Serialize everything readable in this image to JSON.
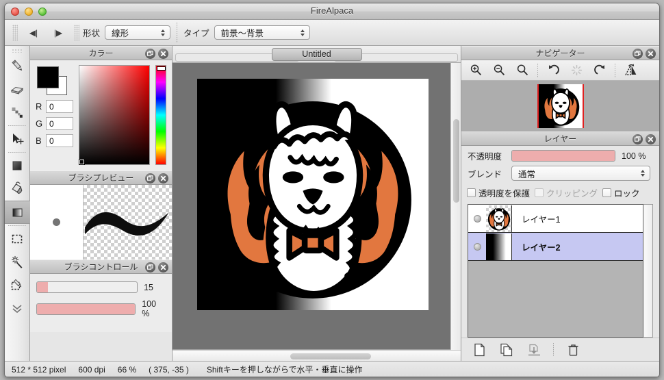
{
  "window": {
    "title": "FireAlpaca",
    "traffic_lights": [
      "close",
      "minimize",
      "zoom"
    ]
  },
  "option_bar": {
    "prev_label": "◀|",
    "next_label": "|▶",
    "shape": {
      "label": "形状",
      "value": "線形"
    },
    "type": {
      "label": "タイプ",
      "value": "前景～背景"
    }
  },
  "tools": [
    {
      "name": "pencil-tool",
      "label": "鉛筆",
      "active": false
    },
    {
      "name": "eraser-tool",
      "label": "消しゴム",
      "active": false
    },
    {
      "name": "blur-tool",
      "label": "ぼかし",
      "active": false
    },
    {
      "name": "move-tool",
      "label": "移動",
      "active": false
    },
    {
      "name": "fill-tool",
      "label": "塗りつぶし",
      "active": false
    },
    {
      "name": "bucket-tool",
      "label": "バケツ",
      "active": false
    },
    {
      "name": "gradient-tool",
      "label": "グラデーション",
      "active": true
    },
    {
      "name": "rect-select-tool",
      "label": "選択範囲",
      "active": false
    },
    {
      "name": "magic-wand-tool",
      "label": "自動選択",
      "active": false
    },
    {
      "name": "select-pen-tool",
      "label": "選択ペン",
      "active": false
    },
    {
      "name": "more-tools",
      "label": "その他",
      "active": false
    }
  ],
  "color_panel": {
    "title": "カラー",
    "foreground": "#000000",
    "background": "#ffffff",
    "channels": [
      {
        "label": "R",
        "value": "0"
      },
      {
        "label": "G",
        "value": "0"
      },
      {
        "label": "B",
        "value": "0"
      }
    ]
  },
  "brush_preview": {
    "title": "ブラシプレビュー"
  },
  "brush_control": {
    "title": "ブラシコントロール",
    "size": {
      "value": "15",
      "percent": 11
    },
    "opacity": {
      "value": "100 %",
      "percent": 100
    }
  },
  "canvas": {
    "tab_title": "Untitled",
    "zoom_percent": "66 %"
  },
  "navigator": {
    "title": "ナビゲーター",
    "tools": [
      {
        "name": "zoom-in-icon",
        "label": "拡大"
      },
      {
        "name": "zoom-out-icon",
        "label": "縮小"
      },
      {
        "name": "zoom-reset-icon",
        "label": "等倍"
      },
      {
        "name": "rotate-left-icon",
        "label": "左回転"
      },
      {
        "name": "rotate-reset-icon",
        "label": "回転リセット"
      },
      {
        "name": "rotate-right-icon",
        "label": "右回転"
      },
      {
        "name": "flip-horizontal-icon",
        "label": "左右反転"
      }
    ]
  },
  "layers_panel": {
    "title": "レイヤー",
    "opacity": {
      "label": "不透明度",
      "value": "100 %",
      "percent": 100
    },
    "blend": {
      "label": "ブレンド",
      "value": "通常"
    },
    "checkboxes": [
      {
        "label": "透明度を保護",
        "checked": false,
        "disabled": false
      },
      {
        "label": "クリッピング",
        "checked": false,
        "disabled": true
      },
      {
        "label": "ロック",
        "checked": false,
        "disabled": false
      }
    ],
    "layers": [
      {
        "name": "レイヤー1",
        "selected": false,
        "thumb": "alpaca"
      },
      {
        "name": "レイヤー2",
        "selected": true,
        "thumb": "gradient"
      }
    ],
    "buttons": [
      {
        "name": "new-layer-button",
        "label": "新規レイヤー"
      },
      {
        "name": "duplicate-layer-button",
        "label": "レイヤーを複製"
      },
      {
        "name": "merge-layer-button",
        "label": "下のレイヤーと結合"
      },
      {
        "name": "delete-layer-button",
        "label": "レイヤーを削除"
      }
    ]
  },
  "panel_head_buttons": {
    "float_label": "フロート",
    "close_label": "閉じる"
  },
  "status_bar": {
    "size": "512 * 512 pixel",
    "dpi": "600 dpi",
    "zoom": "66 %",
    "coords": "( 375, -35 )",
    "hint": "Shiftキーを押しながらで水平・垂直に操作"
  },
  "colors": {
    "accent_pink": "#eeadad",
    "selection_blue": "#c6c8f2",
    "canvas_bg": "#727272",
    "alpaca_orange": "#e2773f"
  }
}
